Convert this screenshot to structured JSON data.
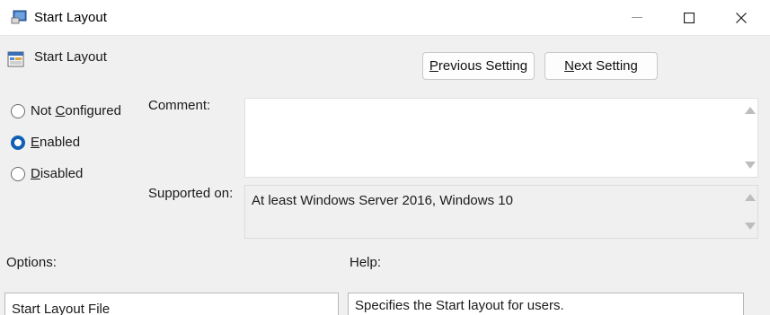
{
  "window": {
    "title": "Start Layout"
  },
  "header": {
    "title": "Start Layout",
    "prev_button_pre": "",
    "prev_button_ul": "P",
    "prev_button_post": "revious Setting",
    "next_button_pre": "",
    "next_button_ul": "N",
    "next_button_post": "ext Setting"
  },
  "state": {
    "options": [
      {
        "pre": "Not ",
        "ul": "C",
        "post": "onfigured",
        "checked": false
      },
      {
        "pre": "",
        "ul": "E",
        "post": "nabled",
        "checked": true
      },
      {
        "pre": "",
        "ul": "D",
        "post": "isabled",
        "checked": false
      }
    ]
  },
  "comment": {
    "label": "Comment:",
    "value": ""
  },
  "supported": {
    "label": "Supported on:",
    "value": "At least Windows Server 2016, Windows 10"
  },
  "options_section": {
    "label": "Options:",
    "first_item": "Start Layout File"
  },
  "help_section": {
    "label": "Help:",
    "text": "Specifies the Start layout for users."
  },
  "colors": {
    "accent": "#0f5fb5",
    "background": "#f0f0f0"
  }
}
